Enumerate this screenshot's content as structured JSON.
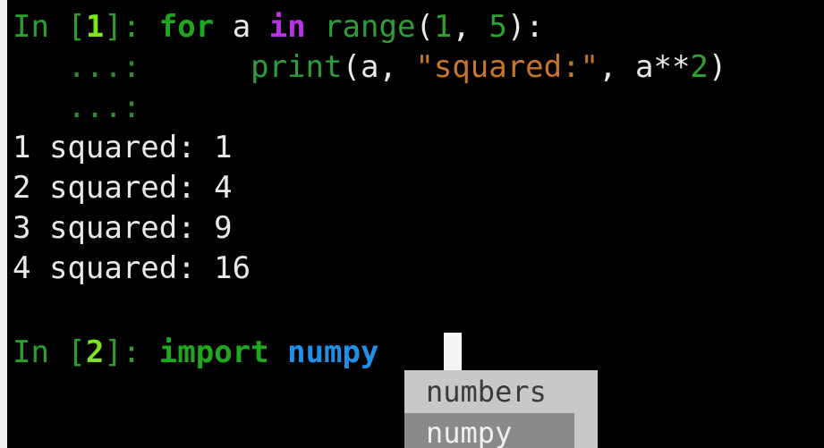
{
  "cell1": {
    "prompt_prefix": "In [",
    "prompt_number": "1",
    "prompt_suffix": "]: ",
    "for_kw": "for",
    "var1": " a ",
    "in_kw": "in",
    "space1": " ",
    "range_fn": "range",
    "paren_open": "(",
    "arg1": "1",
    "comma1": ", ",
    "arg2": "5",
    "paren_close_colon": "):",
    "cont1": "   ...:      ",
    "print_fn": "print",
    "print_open": "(a, ",
    "string_literal": "\"squared:\"",
    "print_mid": ", a**",
    "exponent": "2",
    "print_close": ")",
    "cont2": "   ...:"
  },
  "output_lines": [
    "1 squared: 1",
    "2 squared: 4",
    "3 squared: 9",
    "4 squared: 16"
  ],
  "cell2": {
    "prompt_prefix": "In [",
    "prompt_number": "2",
    "prompt_suffix": "]: ",
    "import_kw": "import",
    "space": " ",
    "module_text": "numpy"
  },
  "completion_menu": {
    "items": [
      "numbers",
      "numpy"
    ],
    "selected_index": 1
  }
}
